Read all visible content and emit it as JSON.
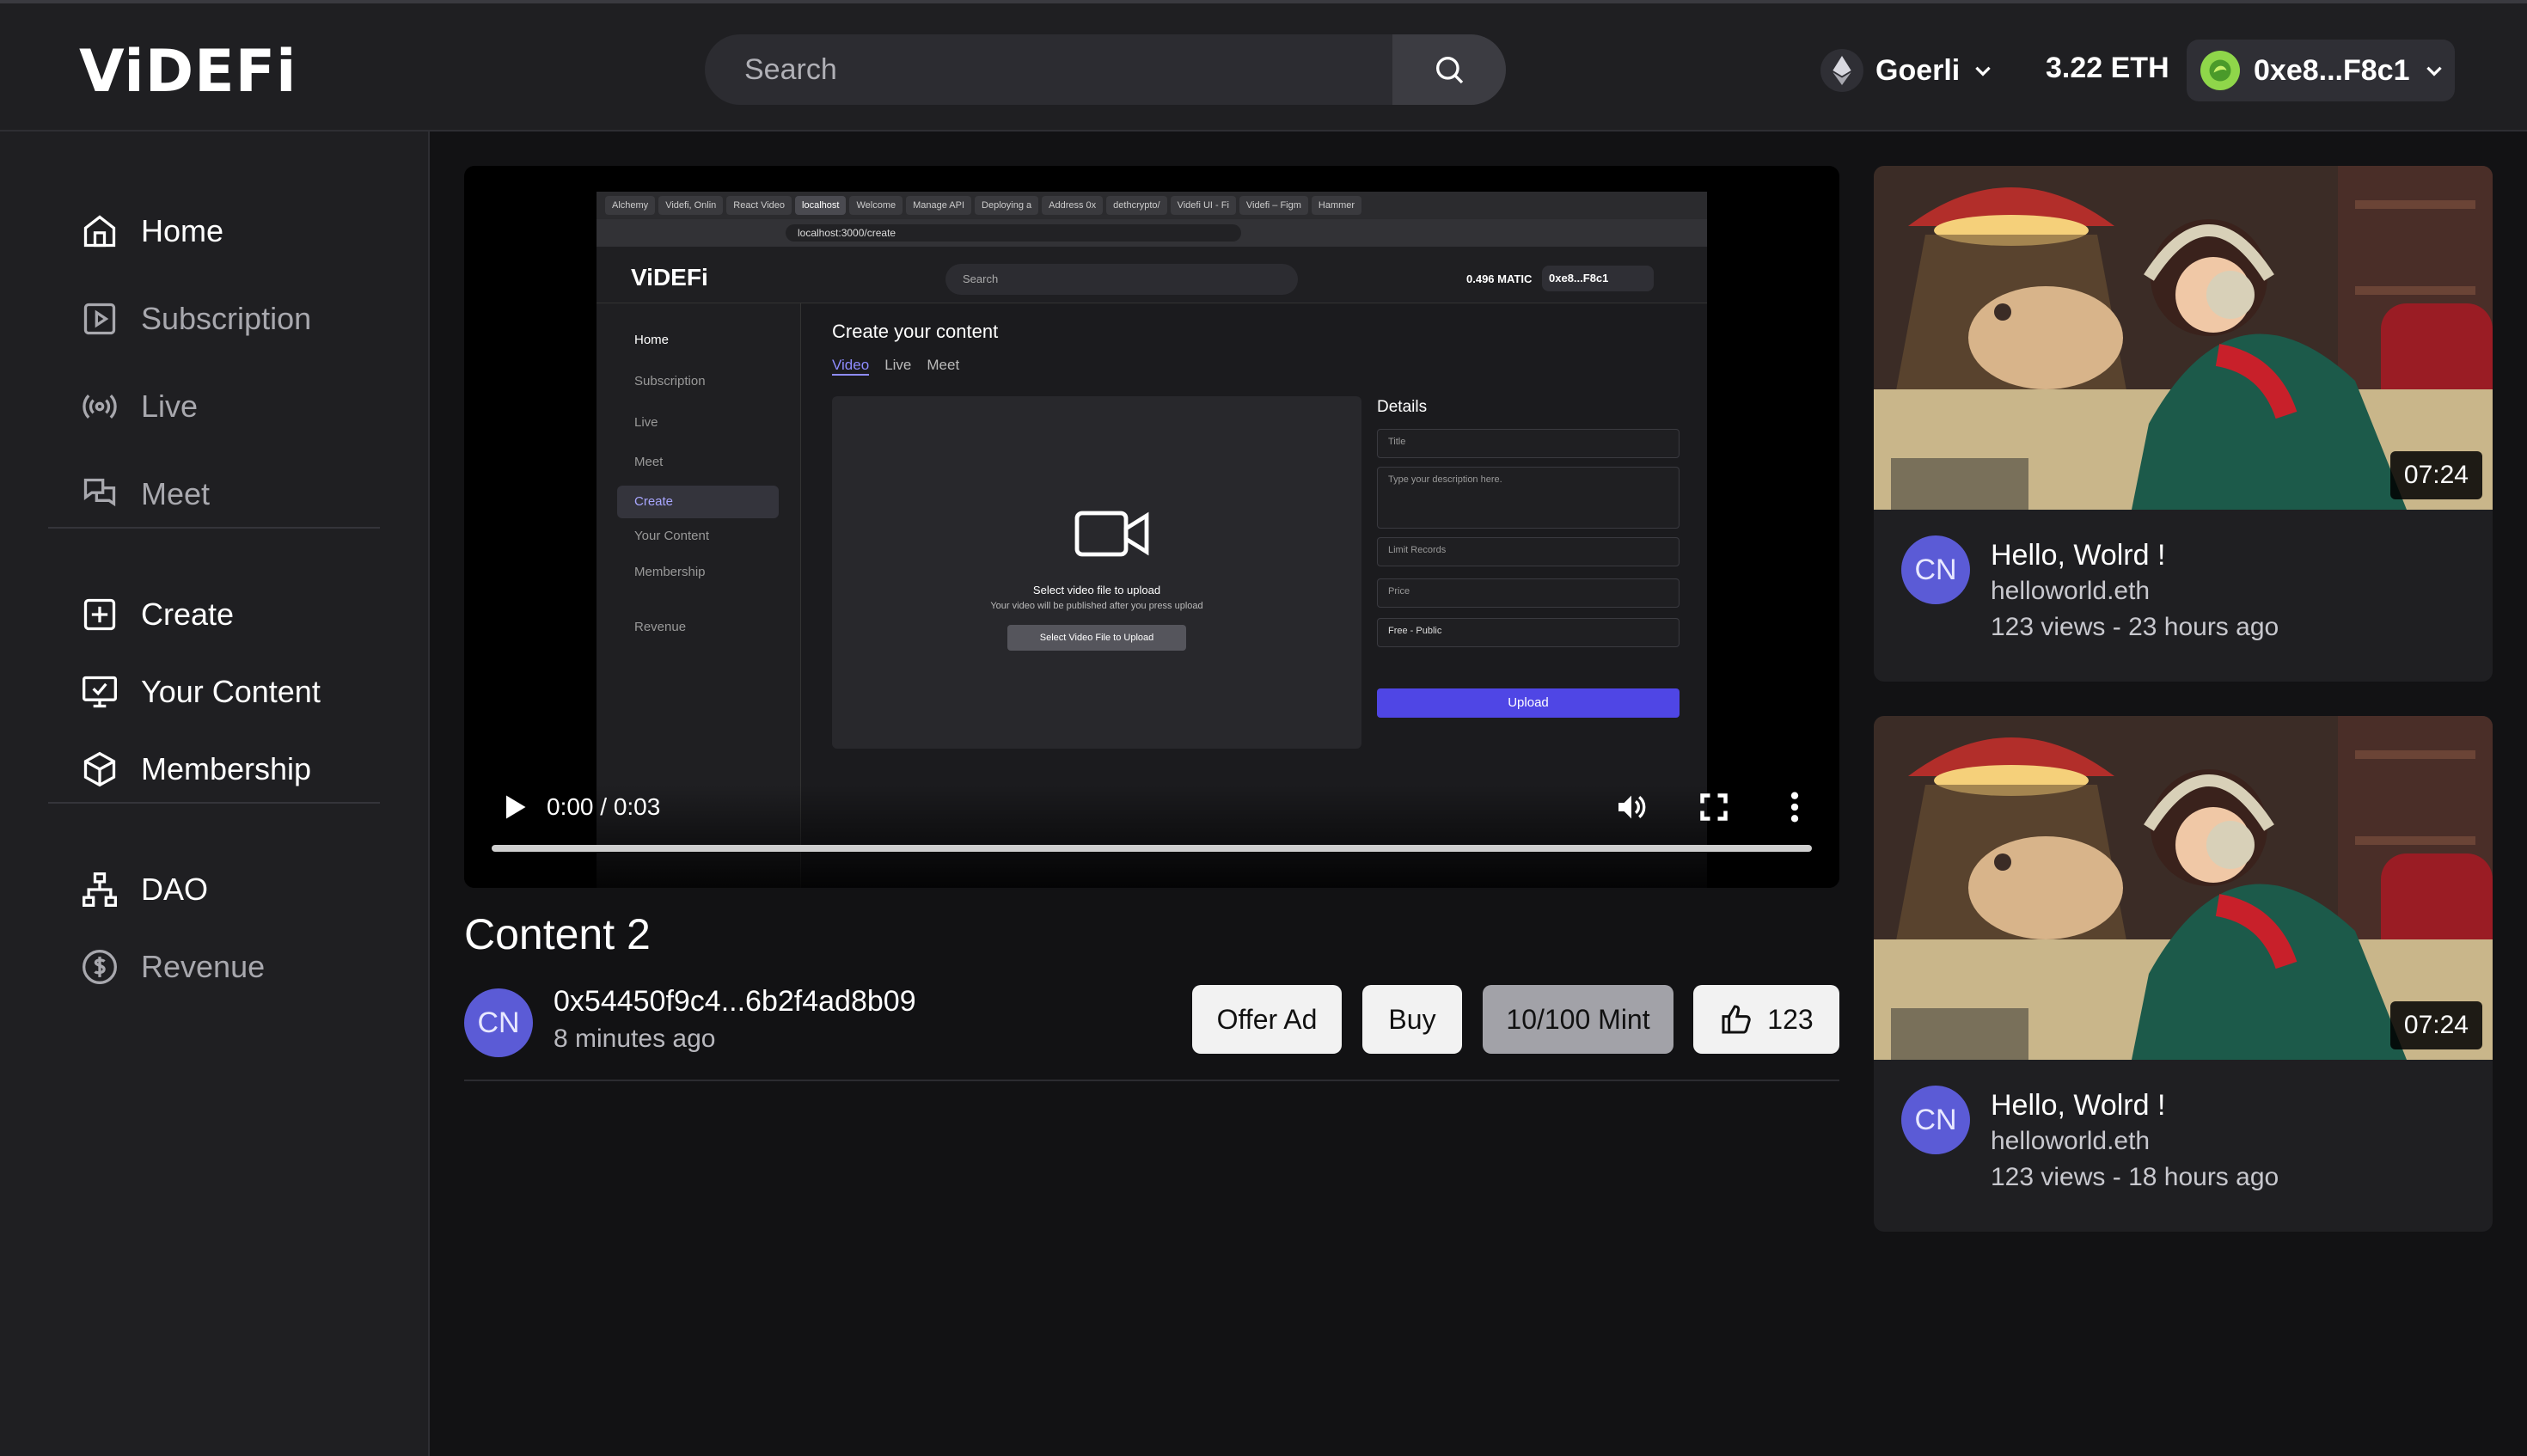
{
  "header": {
    "logo": "ViDEFi",
    "search_placeholder": "Search",
    "network": "Goerli",
    "balance": "3.22 ETH",
    "wallet": "0xe8...F8c1"
  },
  "sidebar": {
    "items": [
      {
        "label": "Home",
        "icon": "home-icon"
      },
      {
        "label": "Subscription",
        "icon": "play-square-icon"
      },
      {
        "label": "Live",
        "icon": "broadcast-icon"
      },
      {
        "label": "Meet",
        "icon": "chat-icon"
      },
      {
        "label": "Create",
        "icon": "plus-square-icon"
      },
      {
        "label": "Your Content",
        "icon": "monitor-check-icon"
      },
      {
        "label": "Membership",
        "icon": "cube-icon"
      },
      {
        "label": "DAO",
        "icon": "hierarchy-icon"
      },
      {
        "label": "Revenue",
        "icon": "dollar-circle-icon"
      }
    ]
  },
  "player": {
    "time": "0:00 / 0:03",
    "progress": 0,
    "frame": {
      "tabs": [
        "Alchemy",
        "Videfi, Onlin",
        "React Video",
        "localhost",
        "Welcome",
        "Manage API",
        "Deploying a",
        "Address 0x",
        "dethcrypto/",
        "Videfi UI - Fi",
        "Videfi – Figm",
        "Hammer"
      ],
      "url": "localhost:3000/create",
      "logo": "ViDEFi",
      "search": "Search",
      "balance": "0.496 MATIC",
      "wallet": "0xe8...F8c1",
      "nav": [
        "Home",
        "Subscription",
        "Live",
        "Meet",
        "Create",
        "Your Content",
        "Membership",
        "Revenue"
      ],
      "page_title": "Create your content",
      "tabs_inner": [
        "Video",
        "Live",
        "Meet"
      ],
      "drop_title": "Select video file to upload",
      "drop_sub": "Your video will be published after you press upload",
      "drop_button": "Select Video File to Upload",
      "details_title": "Details",
      "field_title": "Title",
      "field_desc": "Type your description here.",
      "field_limit": "Limit Records",
      "field_price": "Price",
      "field_access": "Free - Public",
      "upload": "Upload"
    }
  },
  "content": {
    "title": "Content 2",
    "avatar": "CN",
    "address": "0x54450f9c4...6b2f4ad8b09",
    "time_ago": "8 minutes ago",
    "offer_ad": "Offer Ad",
    "buy": "Buy",
    "mint": "10/100 Mint",
    "likes": "123"
  },
  "recommended": [
    {
      "duration": "07:24",
      "avatar": "CN",
      "title": "Hello, Wolrd !",
      "channel": "helloworld.eth",
      "stats": "123 views - 23 hours ago"
    },
    {
      "duration": "07:24",
      "avatar": "CN",
      "title": "Hello, Wolrd !",
      "channel": "helloworld.eth",
      "stats": "123 views - 18 hours ago"
    }
  ]
}
